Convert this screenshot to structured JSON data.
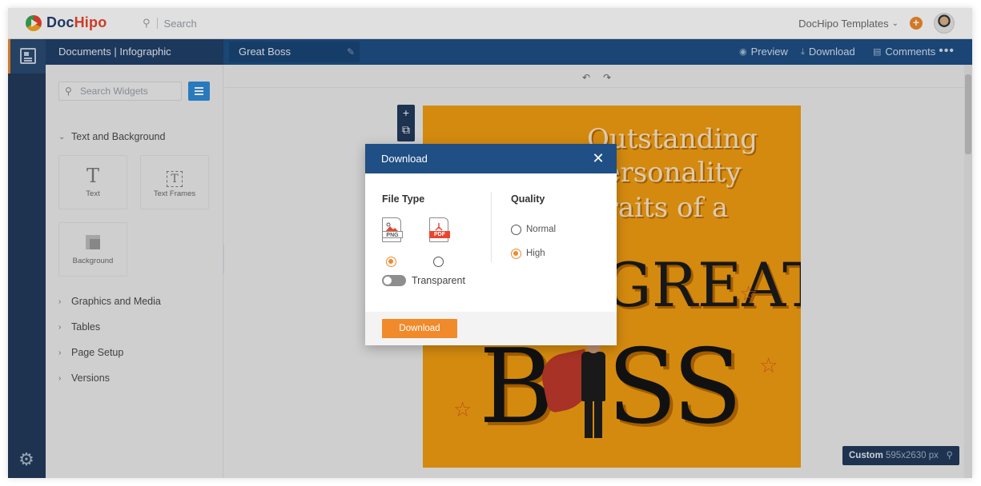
{
  "topbar": {
    "logo_text": "Doc",
    "logo_text_accent": "Hipo",
    "search_placeholder": "Search",
    "templates_label": "DocHipo Templates",
    "add_symbol": "+"
  },
  "band": {
    "section_title": "Documents | Infographic",
    "document_name": "Great Boss",
    "actions": {
      "preview": "Preview",
      "download": "Download",
      "comments": "Comments"
    },
    "more_symbol": "•••"
  },
  "panel": {
    "search_placeholder": "Search Widgets",
    "sections": {
      "text_background": "Text and Background",
      "graphics_media": "Graphics and Media",
      "tables": "Tables",
      "page_setup": "Page Setup",
      "versions": "Versions"
    },
    "tiles": {
      "text": "Text",
      "text_frames": "Text Frames",
      "background": "Background"
    }
  },
  "artboard": {
    "headline_lines": [
      "Outstanding",
      "Personality",
      "Traits of a"
    ],
    "great": "GREAT",
    "boss_left": "B",
    "boss_right": "SS"
  },
  "zoom": {
    "mode": "Custom",
    "size": "595x2630 px"
  },
  "modal": {
    "title": "Download",
    "file_type_label": "File Type",
    "quality_label": "Quality",
    "file_types": [
      {
        "tag": "PNG",
        "selected": true
      },
      {
        "tag": "PDF",
        "selected": false
      }
    ],
    "quality_options": [
      {
        "label": "Normal",
        "selected": false
      },
      {
        "label": "High",
        "selected": true
      }
    ],
    "transparent_label": "Transparent",
    "transparent_on": false,
    "download_button": "Download"
  },
  "colors": {
    "navy": "#213b5c",
    "header_blue": "#1e4f86",
    "accent_orange": "#f08a2b",
    "artboard_orange": "#f29e12"
  },
  "icons": [
    "search-icon",
    "chevron-down-icon",
    "plus-icon",
    "document-icon",
    "gear-icon",
    "pencil-icon",
    "eye-icon",
    "download-icon",
    "comment-icon",
    "list-icon",
    "undo-icon",
    "redo-icon",
    "zoom-icon",
    "close-icon",
    "png-file-icon",
    "pdf-file-icon"
  ]
}
